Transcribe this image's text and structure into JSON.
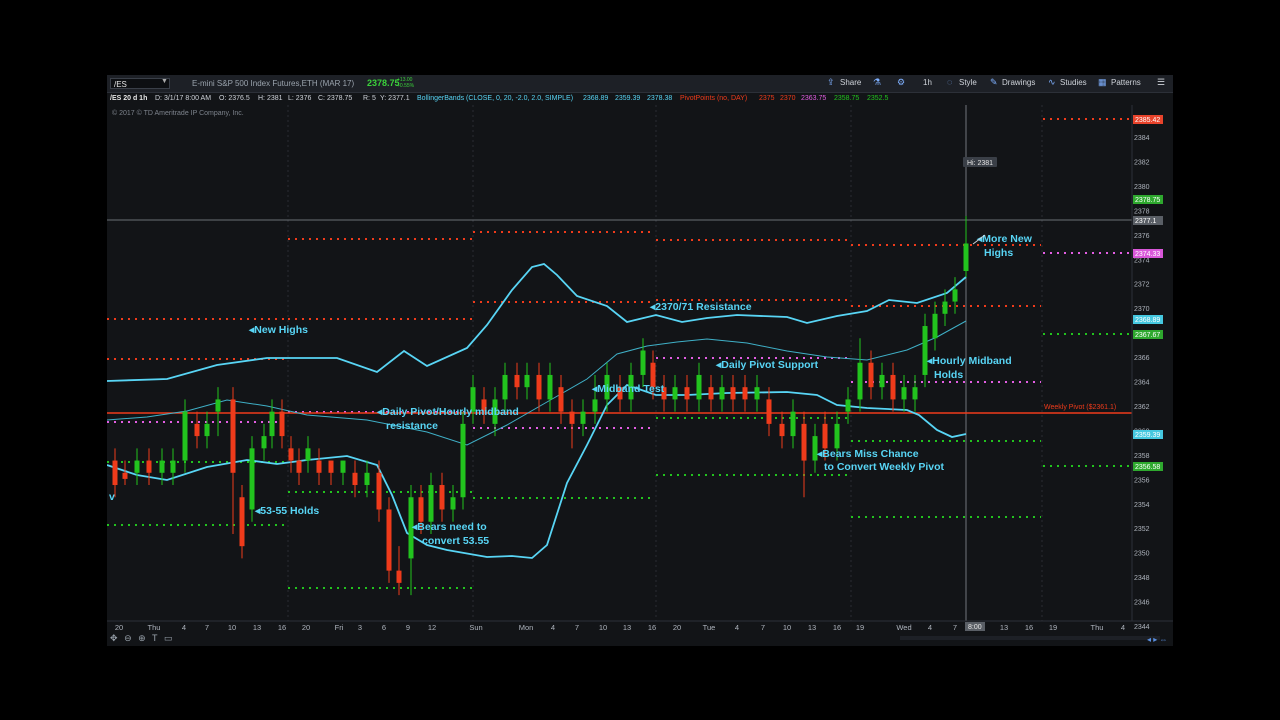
{
  "toolbar": {
    "symbol": "/ES",
    "instrument": "E-mini S&P 500 Index Futures,ETH (MAR 17)",
    "last_price": "2378.75",
    "change": "+13.00",
    "change_pct": "+0.55%",
    "share": "Share",
    "timeframe": "1h",
    "style": "Style",
    "drawings": "Drawings",
    "studies": "Studies",
    "patterns": "Patterns"
  },
  "ohlc": {
    "period": "/ES 20 d 1h",
    "date": "D: 3/1/17 8:00 AM",
    "open": "O: 2376.5",
    "high": "H: 2381",
    "low": "L: 2376",
    "close": "C: 2378.75",
    "range": "R: 5",
    "y": "Y: 2377.1"
  },
  "studies": {
    "bb_label": "BollingerBands (CLOSE, 0, 20, -2.0, 2.0, SIMPLE)",
    "bb_values": [
      "2368.89",
      "2359.39",
      "2378.38"
    ],
    "pp_label": "PivotPoints (no, DAY)",
    "pp_values": [
      "2375",
      "2370",
      "2363.75",
      "2358.75",
      "2352.5"
    ]
  },
  "copyright": "© 2017 © TD Ameritrade IP Company, Inc.",
  "hi_label": "Hi: 2381",
  "price_axis": {
    "ticks": [
      "2384",
      "2382",
      "2380",
      "2378",
      "2376",
      "2374",
      "2372",
      "2370",
      "2368",
      "2366",
      "2364",
      "2362",
      "2360",
      "2358",
      "2356",
      "2354",
      "2352",
      "2350",
      "2348",
      "2346",
      "2344"
    ],
    "bubbles": [
      {
        "text": "2385.42",
        "color": "#e8432b"
      },
      {
        "text": "2378.75",
        "color": "#2ea82e"
      },
      {
        "text": "2377.1",
        "color": "#5a5f66"
      },
      {
        "text": "2374.33",
        "color": "#d957d9"
      },
      {
        "text": "2368.89",
        "color": "#45c8e0"
      },
      {
        "text": "2367.67",
        "color": "#2ea82e"
      },
      {
        "text": "2359.39",
        "color": "#45c8e0"
      },
      {
        "text": "2356.58",
        "color": "#2ea82e"
      }
    ]
  },
  "time_axis": {
    "labels": [
      "20",
      "Thu",
      "4",
      "7",
      "10",
      "13",
      "16",
      "20",
      "Fri",
      "3",
      "6",
      "9",
      "12",
      "Sun",
      "Mon",
      "4",
      "7",
      "10",
      "13",
      "16",
      "20",
      "Tue",
      "4",
      "7",
      "10",
      "13",
      "16",
      "19",
      "Wed",
      "4",
      "7",
      "13",
      "16",
      "19",
      "Thu",
      "4"
    ],
    "cursor": "8:00"
  },
  "weekly_pivot": "Weekly Pivot ($2361.1)",
  "annotations": {
    "new_highs": "New Highs",
    "daily_pivot_1": "Daily Pivot/Hourly midband",
    "daily_pivot_2": "resistance",
    "holds_5355": "53-55 Holds",
    "bears_convert_1": "Bears need to",
    "bears_convert_2": "convert 53.55",
    "resistance_7071": "2370/71 Resistance",
    "midband_test": "Midband Test",
    "daily_pivot_support": "Daily Pivot Support",
    "bears_miss_1": "Bears Miss Chance",
    "bears_miss_2": "to Convert Weekly Pivot",
    "hourly_midband_1": "Hourly Midband",
    "hourly_midband_2": "Holds",
    "more_new_1": "More New",
    "more_new_2": "Highs",
    "left_v": "v"
  },
  "colors": {
    "up": "#22c31e",
    "down": "#ef3b1b",
    "band": "#58d5f5",
    "pivot_r": "#ef3b1b",
    "pivot_s": "#22c31e",
    "pivot_p": "#e35ee3",
    "annotation": "#58d5f5"
  }
}
